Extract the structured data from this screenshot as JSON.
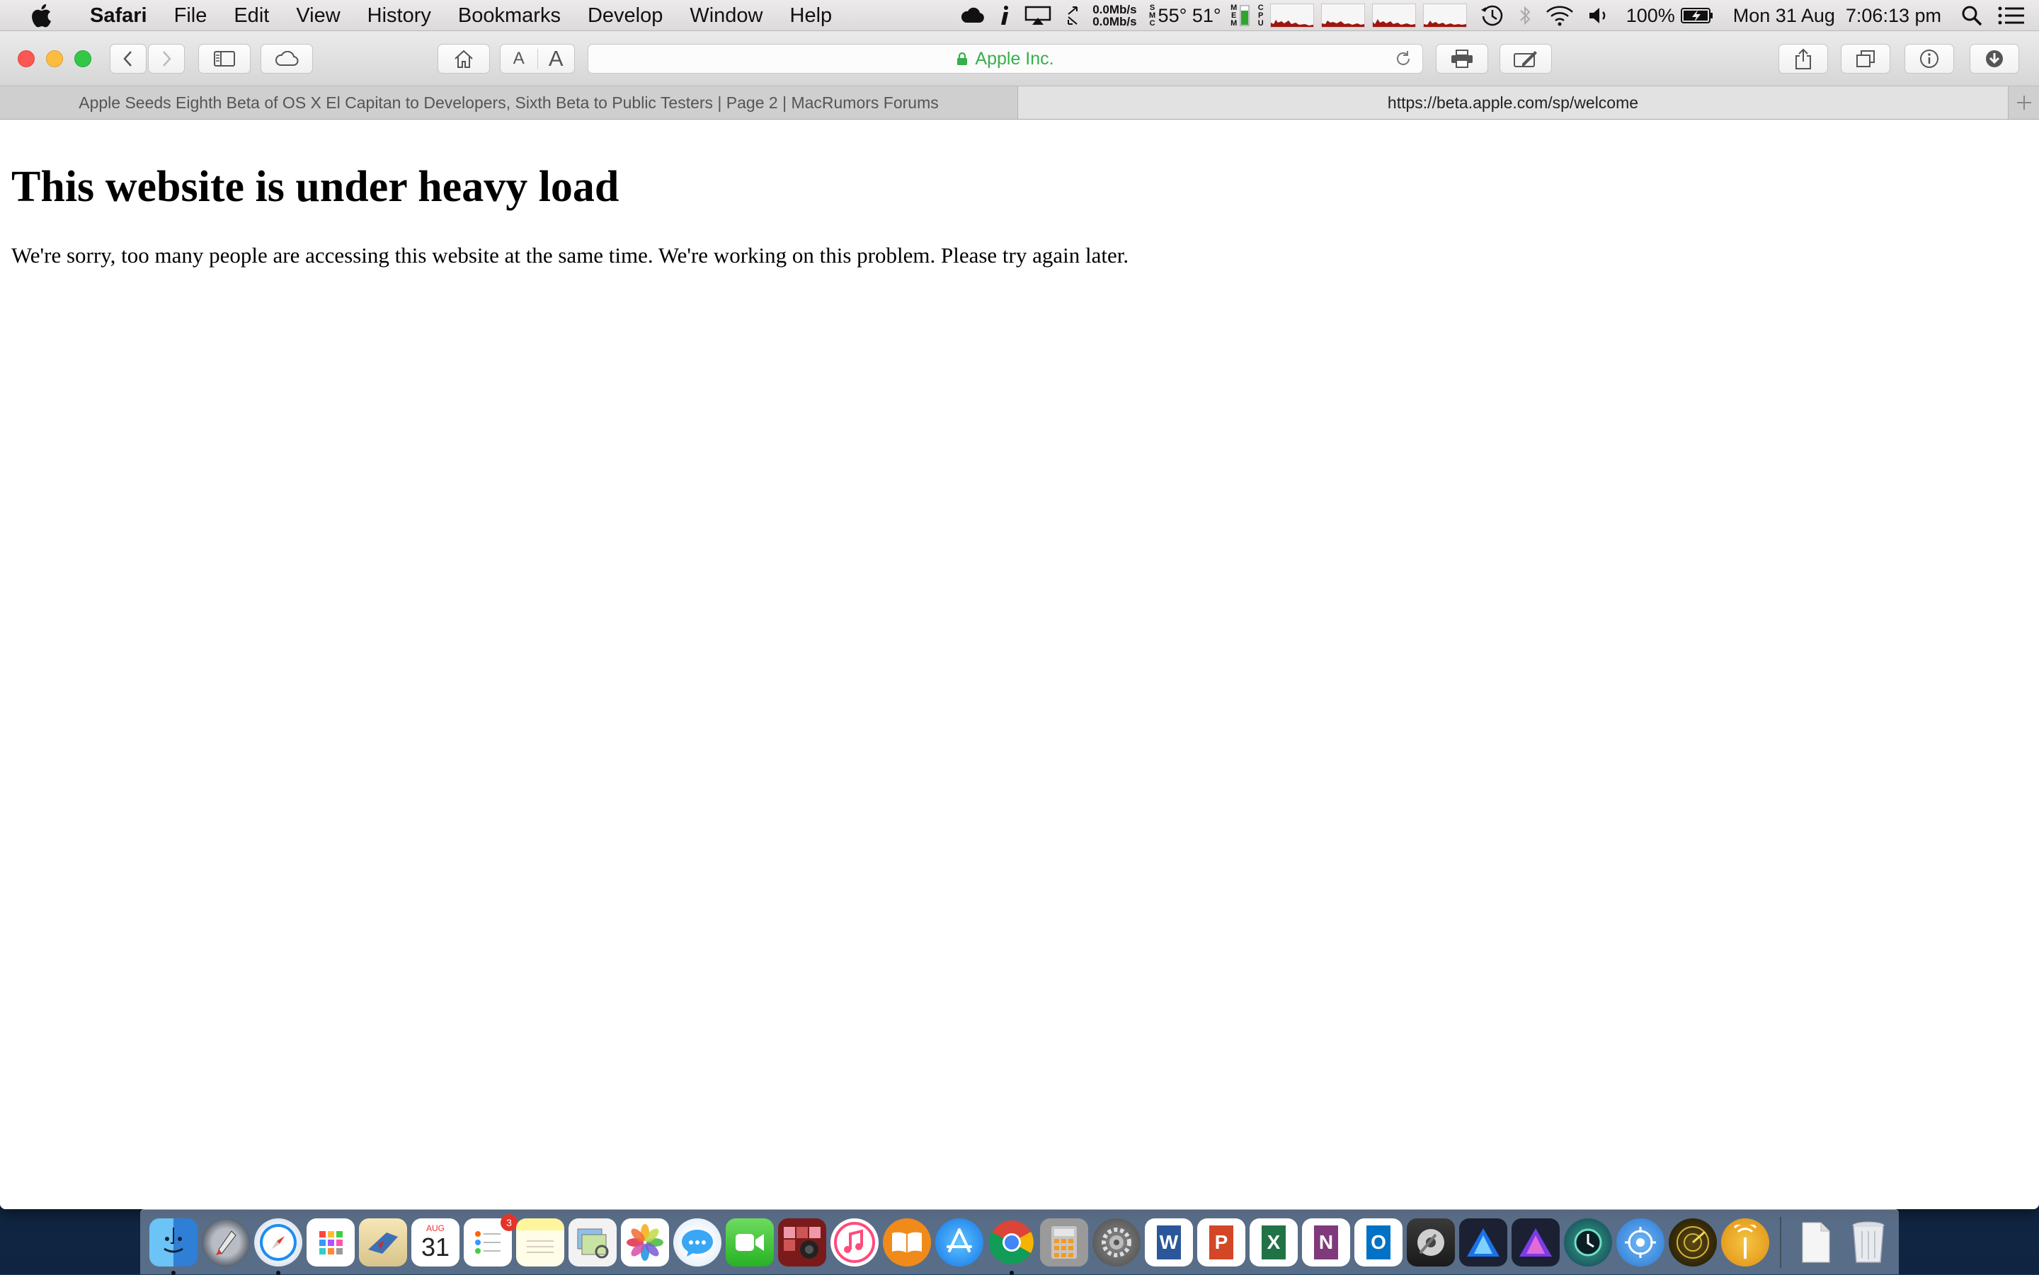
{
  "menubar": {
    "app_name": "Safari",
    "items": [
      "File",
      "Edit",
      "View",
      "History",
      "Bookmarks",
      "Develop",
      "Window",
      "Help"
    ],
    "net_up": "0.0Mb/s",
    "net_down": "0.0Mb/s",
    "temp_label": "55° 51°",
    "battery_percent": "100%",
    "datetime": "Mon 31 Aug  7:06:13 pm"
  },
  "toolbar": {
    "address_text": "Apple Inc.",
    "font_small_label": "A",
    "font_large_label": "A"
  },
  "tabs": [
    {
      "title": "Apple Seeds Eighth Beta of OS X El Capitan to Developers, Sixth Beta to Public Testers | Page 2 | MacRumors Forums",
      "active": false
    },
    {
      "title": "https://beta.apple.com/sp/welcome",
      "active": true
    }
  ],
  "page": {
    "heading": "This website is under heavy load",
    "message": "We're sorry, too many people are accessing this website at the same time. We're working on this problem. Please try again later."
  },
  "dock": {
    "calendar_month": "AUG",
    "calendar_day": "31",
    "reminders_badge": "3",
    "word_letter": "W",
    "powerpoint_letter": "P",
    "excel_letter": "X",
    "onenote_letter": "N",
    "outlook_letter": "O"
  },
  "colors": {
    "secure_green": "#35b04b",
    "close": "#fc5753",
    "minimize": "#fdbc40",
    "maximize": "#33c748"
  }
}
